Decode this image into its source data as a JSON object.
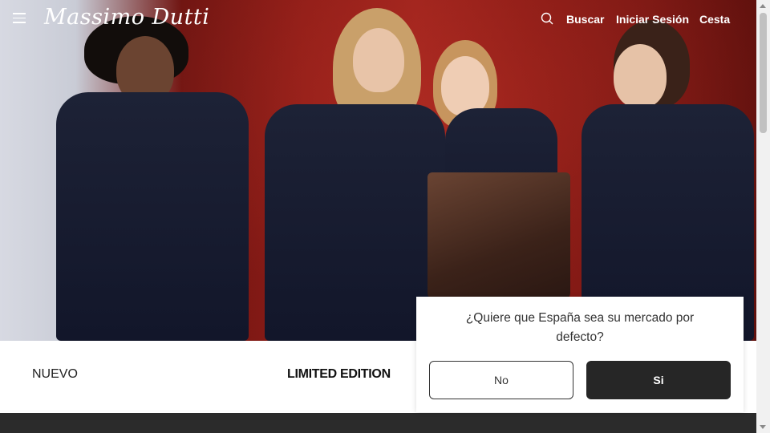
{
  "header": {
    "logo": "Massimo Dutti",
    "nav": {
      "search_label": "Buscar",
      "login_label": "Iniciar Sesión",
      "cart_label": "Cesta"
    },
    "icons": {
      "menu": "hamburger-menu-icon",
      "search": "search-icon"
    }
  },
  "strip": {
    "left_label": "NUEVO",
    "center_label": "LIMITED EDITION"
  },
  "modal": {
    "question": "¿Quiere que España sea su mercado por defecto?",
    "no_label": "No",
    "yes_label": "Si"
  },
  "colors": {
    "hero_red": "#8d1c17",
    "navy_coat": "#1d2236",
    "dark_button": "#262626",
    "footer": "#2b2b2b"
  }
}
